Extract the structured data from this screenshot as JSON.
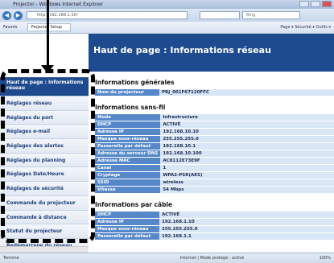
{
  "browser": {
    "title": "Projector - Windows Internet Explorer",
    "url": "http://192.168.1.10/",
    "search_placeholder": "Bing",
    "favorites_label": "Favoris",
    "tab_label": "Projector Setup",
    "tools_label": "Page ▾ Sécurité ▾ Outils ▾",
    "status_left": "Terminé",
    "status_mid": "Internet | Mode protégé : activé",
    "zoom": "100%"
  },
  "sidebar": {
    "items": [
      {
        "label": "Haut de page : Informations réseau"
      },
      {
        "label": "Réglages réseau"
      },
      {
        "label": "Réglages du port"
      },
      {
        "label": "Réglages e-mail"
      },
      {
        "label": "Réglages des alertes"
      },
      {
        "label": "Réglages du planning"
      },
      {
        "label": "Réglages Date/Heure"
      },
      {
        "label": "Réglages de sécurité"
      },
      {
        "label": "Commande du projecteur"
      },
      {
        "label": "Commande à distance"
      },
      {
        "label": "Statut du projecteur"
      },
      {
        "label": "Redémarrage du réseau"
      }
    ]
  },
  "page": {
    "title": "Haut de page : Informations réseau",
    "sections": [
      {
        "title": "Informations générales",
        "rows": [
          {
            "key": "Nom du projecteur",
            "value": "PRJ_001F67120FFC"
          }
        ]
      },
      {
        "title": "Informations sans-fil",
        "rows": [
          {
            "key": "Mode",
            "value": "Infrastructure"
          },
          {
            "key": "DHCP",
            "value": "ACTIVÉ"
          },
          {
            "key": "Adresse IP",
            "value": "192.168.10.10"
          },
          {
            "key": "Masque sous-réseau",
            "value": "255.255.255.0"
          },
          {
            "key": "Passerelle par défaut",
            "value": "192.168.10.1"
          },
          {
            "key": "Adresse du serveur DNS",
            "value": "192.168.10.100"
          },
          {
            "key": "Adresse MAC",
            "value": "AC8112E73E9F"
          },
          {
            "key": "Canal",
            "value": "1"
          },
          {
            "key": "Cryptage",
            "value": "WPA2-PSK(AES)"
          },
          {
            "key": "SSID",
            "value": "wireless"
          },
          {
            "key": "Vitesse",
            "value": "54 Mbps"
          }
        ]
      },
      {
        "title": "Informations par câble",
        "rows": [
          {
            "key": "DHCP",
            "value": "ACTIVÉ"
          },
          {
            "key": "Adresse IP",
            "value": "192.168.1.10"
          },
          {
            "key": "Masque sous-réseau",
            "value": "255.255.255.0"
          },
          {
            "key": "Passerelle par défaut",
            "value": "192.168.1.1"
          }
        ]
      }
    ]
  }
}
